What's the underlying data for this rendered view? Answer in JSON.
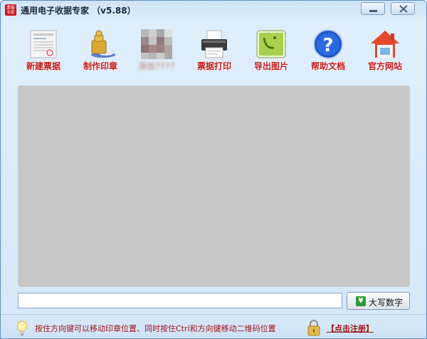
{
  "window": {
    "title": "通用电子收据专家 （v5.88）",
    "icon_text": "票据专家"
  },
  "toolbar": {
    "items": [
      {
        "key": "new",
        "label": "新建票据",
        "icon": "document-icon"
      },
      {
        "key": "seal",
        "label": "制作印章",
        "icon": "stamp-icon"
      },
      {
        "key": "add",
        "label": "添加????",
        "icon": "pixelated-icon"
      },
      {
        "key": "print",
        "label": "票据打印",
        "icon": "printer-icon"
      },
      {
        "key": "export",
        "label": "导出图片",
        "icon": "image-icon"
      },
      {
        "key": "help",
        "label": "帮助文档",
        "icon": "help-icon"
      },
      {
        "key": "site",
        "label": "官方网站",
        "icon": "home-icon"
      }
    ]
  },
  "input": {
    "value": "",
    "placeholder": ""
  },
  "convert_button": {
    "label": "大写数字",
    "icon_text": "¥"
  },
  "status": {
    "hint": "按住方向键可以移动印章位置、同时按住Ctrl和方向键移动二维码位置",
    "register": "【点击注册】"
  },
  "colors": {
    "label_red": "#c21a1a",
    "canvas_gray": "#c8c8c8",
    "title_bar": "#cfe4f7"
  }
}
